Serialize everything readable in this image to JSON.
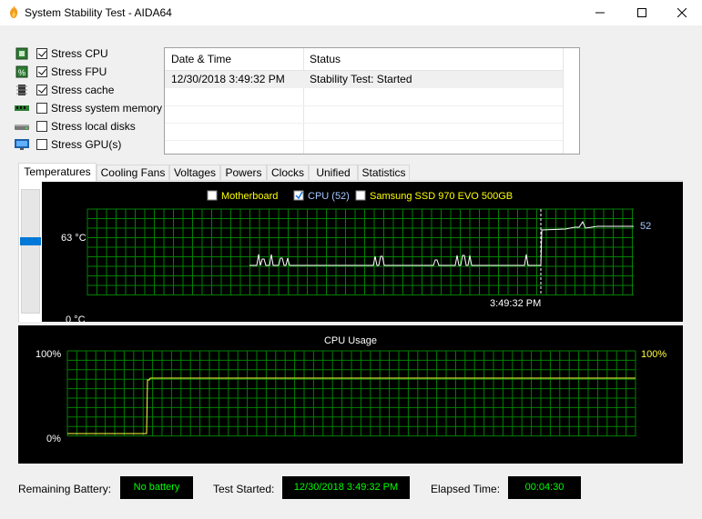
{
  "window": {
    "title": "System Stability Test - AIDA64"
  },
  "stress_options": [
    {
      "label": "Stress CPU",
      "checked": true,
      "icon": "cpu-chip-icon"
    },
    {
      "label": "Stress FPU",
      "checked": true,
      "icon": "fpu-percent-icon"
    },
    {
      "label": "Stress cache",
      "checked": true,
      "icon": "cache-chip-icon"
    },
    {
      "label": "Stress system memory",
      "checked": false,
      "icon": "memory-module-icon"
    },
    {
      "label": "Stress local disks",
      "checked": false,
      "icon": "hard-disk-icon"
    },
    {
      "label": "Stress GPU(s)",
      "checked": false,
      "icon": "monitor-gpu-icon"
    }
  ],
  "status_table": {
    "headers": [
      "Date & Time",
      "Status"
    ],
    "rows": [
      {
        "datetime": "12/30/2018 3:49:32 PM",
        "status": "Stability Test: Started"
      }
    ]
  },
  "tabs": [
    "Temperatures",
    "Cooling Fans",
    "Voltages",
    "Powers",
    "Clocks",
    "Unified",
    "Statistics"
  ],
  "active_tab": "Temperatures",
  "temperature_chart": {
    "legend": [
      {
        "label": "Motherboard",
        "checked": false,
        "color": "#ffff00"
      },
      {
        "label": "CPU (52)",
        "checked": true,
        "color": "#a6c8ff"
      },
      {
        "label": "Samsung SSD 970 EVO 500GB",
        "checked": false,
        "color": "#ffff00"
      }
    ],
    "y_max_label": "63 °C",
    "y_min_label": "0 °C",
    "marker_time": "3:49:32 PM",
    "current_value_label": "52",
    "line_color": "#ffffff",
    "grid_color": "#008000"
  },
  "cpu_usage_chart": {
    "title": "CPU Usage",
    "y_max_label": "100%",
    "y_min_label": "0%",
    "current_value_label": "100%",
    "line_color": "#ffff40",
    "grid_color": "#008000"
  },
  "status_bar": {
    "battery_label": "Remaining Battery:",
    "battery_value": "No battery",
    "started_label": "Test Started:",
    "started_value": "12/30/2018 3:49:32 PM",
    "elapsed_label": "Elapsed Time:",
    "elapsed_value": "00:04:30"
  }
}
